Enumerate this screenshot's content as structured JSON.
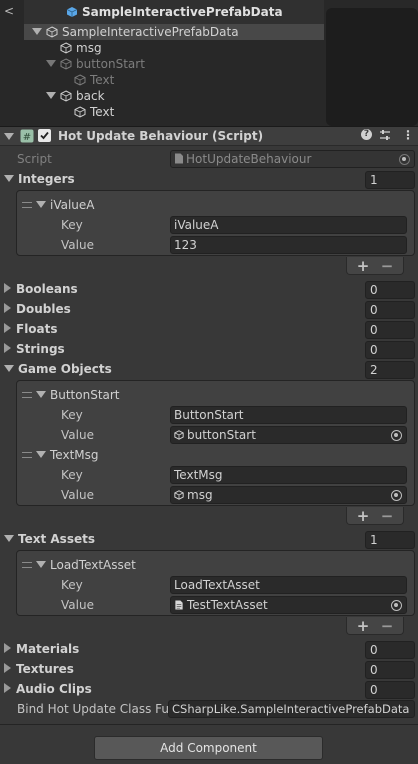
{
  "hierarchy": {
    "title": "SampleInteractivePrefabData",
    "root": "SampleInteractivePrefabData",
    "items": [
      {
        "label": "msg"
      },
      {
        "label": "buttonStart"
      },
      {
        "label": "Text"
      },
      {
        "label": "back"
      },
      {
        "label": "Text"
      }
    ]
  },
  "component": {
    "title": "Hot Update Behaviour (Script)",
    "script_label": "Script",
    "script_value": "HotUpdateBehaviour"
  },
  "integers": {
    "label": "Integers",
    "count": "1",
    "entries": [
      {
        "name": "iValueA",
        "key_label": "Key",
        "key": "iValueA",
        "value_label": "Value",
        "value": "123"
      }
    ]
  },
  "collapsed": [
    {
      "label": "Booleans",
      "count": "0"
    },
    {
      "label": "Doubles",
      "count": "0"
    },
    {
      "label": "Floats",
      "count": "0"
    },
    {
      "label": "Strings",
      "count": "0"
    }
  ],
  "game_objects": {
    "label": "Game Objects",
    "count": "2",
    "entries": [
      {
        "name": "ButtonStart",
        "key_label": "Key",
        "key": "ButtonStart",
        "value_label": "Value",
        "value": "buttonStart"
      },
      {
        "name": "TextMsg",
        "key_label": "Key",
        "key": "TextMsg",
        "value_label": "Value",
        "value": "msg"
      }
    ]
  },
  "text_assets": {
    "label": "Text Assets",
    "count": "1",
    "entries": [
      {
        "name": "LoadTextAsset",
        "key_label": "Key",
        "key": "LoadTextAsset",
        "value_label": "Value",
        "value": "TestTextAsset"
      }
    ]
  },
  "collapsed2": [
    {
      "label": "Materials",
      "count": "0"
    },
    {
      "label": "Textures",
      "count": "0"
    },
    {
      "label": "Audio Clips",
      "count": "0"
    }
  ],
  "bind": {
    "label": "Bind Hot Update Class Full",
    "value": "CSharpLike.SampleInteractivePrefabData"
  },
  "buttons": {
    "plus": "+",
    "minus": "−",
    "add_component": "Add Component",
    "back": "<"
  }
}
